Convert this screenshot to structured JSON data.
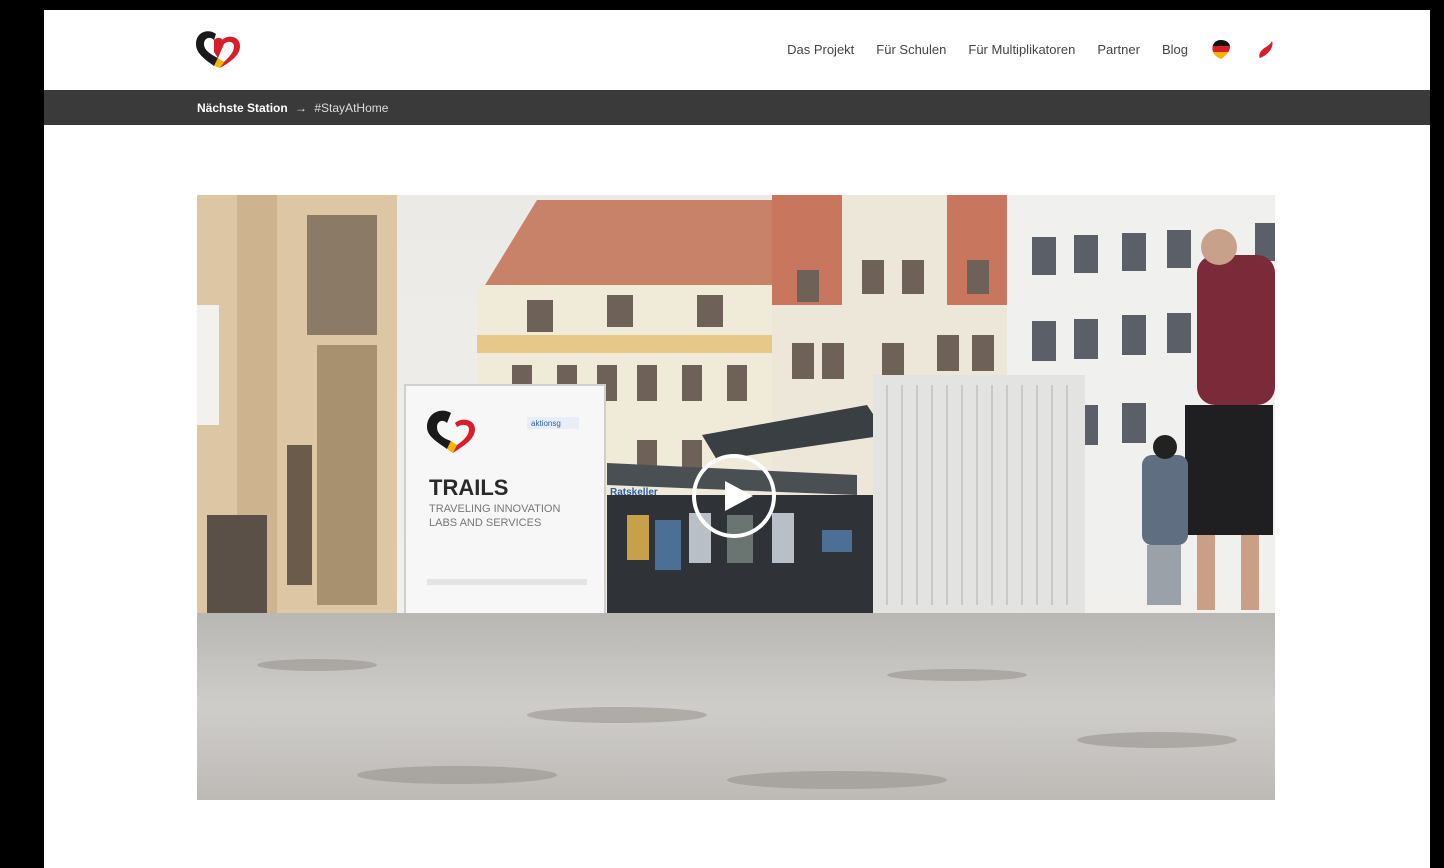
{
  "header": {
    "logo_icon": "trails-heart-logo-icon",
    "nav": [
      {
        "label": "Das Projekt"
      },
      {
        "label": "Für Schulen"
      },
      {
        "label": "Für Multiplikatoren"
      },
      {
        "label": "Partner"
      },
      {
        "label": "Blog"
      }
    ],
    "lang_de_icon": "german-flag-icon",
    "lang_pl_icon": "polish-flag-icon"
  },
  "ticker": {
    "label": "Nächste Station",
    "arrow": "→",
    "tag": "#StayAtHome"
  },
  "video": {
    "play_icon": "play-circle-icon",
    "sign": {
      "title": "TRAILS",
      "line1": "TRAVELING INNOVATION",
      "line2": "LABS AND SERVICES",
      "partner": "aktionsg"
    },
    "shop_sign": "Ratskeller"
  },
  "colors": {
    "ticker_bg": "#3a3a3a",
    "brand_red": "#d91e2a",
    "brand_yellow": "#f4b400",
    "brand_black": "#1a1a1a"
  }
}
